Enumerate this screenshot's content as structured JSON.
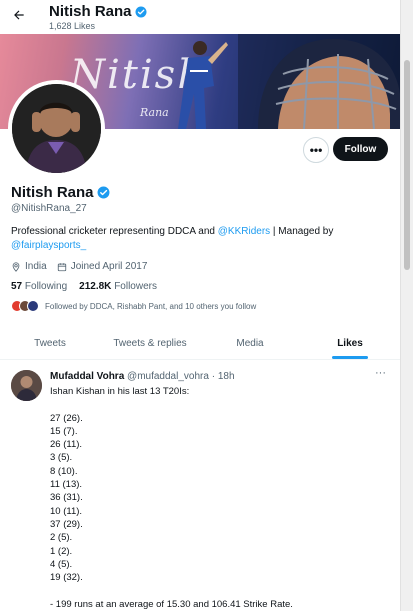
{
  "header": {
    "name": "Nitish Rana",
    "likes_count": "1,628 Likes",
    "back_icon": "arrow-left-icon",
    "verified_icon": "verified-badge-icon"
  },
  "banner": {
    "signature": "Nitish",
    "signature_small": "Rana"
  },
  "actions": {
    "more_label": "•••",
    "follow_label": "Follow"
  },
  "profile": {
    "name": "Nitish Rana",
    "handle": "@NitishRana_27",
    "bio_text_1": "Professional cricketer representing DDCA and ",
    "bio_link_1": "@KKRiders",
    "bio_text_2": " | Managed by",
    "bio_link_2": "@fairplaysports_",
    "location": "India",
    "joined": "Joined April 2017",
    "following_count": "57",
    "following_label": "Following",
    "followers_count": "212.8K",
    "followers_label": "Followers",
    "followed_by": "Followed by DDCA, Rishabh Pant, and 10 others you follow"
  },
  "tabs": [
    {
      "label": "Tweets"
    },
    {
      "label": "Tweets & replies"
    },
    {
      "label": "Media"
    },
    {
      "label": "Likes"
    }
  ],
  "tweet": {
    "author": "Mufaddal Vohra",
    "handle": "@mufaddal_vohra",
    "separator": "·",
    "time": "18h",
    "more": "···",
    "lines": [
      "Ishan Kishan in his last 13 T20Is:",
      "",
      "27 (26).",
      "15 (7).",
      "26 (11).",
      "3 (5).",
      "8 (10).",
      "11 (13).",
      "36 (31).",
      "10 (11).",
      "37 (29).",
      "2 (5).",
      "1 (2).",
      "4 (5).",
      "19 (32).",
      "",
      "- 199 runs at an average of 15.30 and 106.41 Strike Rate."
    ]
  },
  "colors": {
    "accent": "#1d9bf0",
    "text": "#0f1419",
    "muted": "#536471"
  }
}
